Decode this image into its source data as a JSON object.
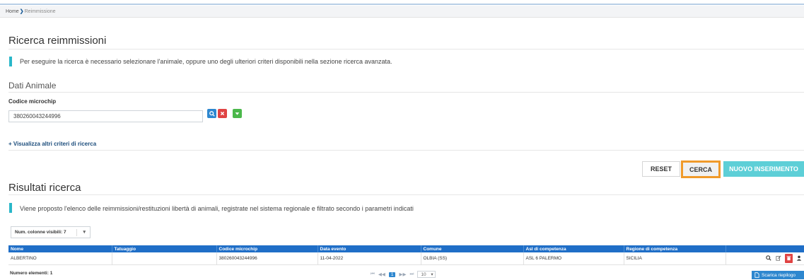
{
  "breadcrumb": {
    "home": "Home",
    "separator": "❯",
    "current": "Reimmissione"
  },
  "search": {
    "title": "Ricerca reimmissioni",
    "info": "Per eseguire la ricerca è necessario selezionare l'animale, oppure uno degli ulteriori criteri disponibili nella sezione ricerca avanzata.",
    "animal_section": "Dati Animale",
    "microchip_label": "Codice microchip",
    "microchip_value": "380260043244996",
    "advanced_link": "+ Visualizza altri criteri di ricerca",
    "icons": {
      "search": "search-icon",
      "clear": "close-icon",
      "more": "chevron-down-icon"
    }
  },
  "actions": {
    "reset": "RESET",
    "cerca": "CERCA",
    "nuovo": "NUOVO INSERIMENTO"
  },
  "results": {
    "title": "Risultati ricerca",
    "info": "Viene proposto l'elenco delle reimmissioni/restituzioni libertà di animali, registrate nel sistema regionale e filtrato secondo i parametri indicati",
    "columns_select": "Num. colonne visibili: 7",
    "columns": [
      "Nome",
      "Tatuaggio",
      "Codice microchip",
      "Data evento",
      "Comune",
      "Asl di competenza",
      "Regione di competenza"
    ],
    "rows": [
      [
        "ALBERTINO",
        "",
        "380260043244996",
        "11-04-2022",
        "OLBIA (SS)",
        "ASL 6 PALERMO",
        "SICILIA"
      ]
    ],
    "row_icons": [
      "search-icon",
      "edit-icon",
      "trash-icon",
      "user-icon"
    ],
    "count": "Numero elementi: 1",
    "pager": {
      "first": "⏮",
      "prev": "◀◀",
      "current": "1",
      "next": "▶▶",
      "last": "⏭",
      "page_size": "10"
    },
    "download": "Scarica riepilogo"
  },
  "colors": {
    "accent": "#1f6ec7",
    "info_bar": "#2ab7c9",
    "highlight": "#f09a2a",
    "new_button": "#5dcfd7"
  }
}
